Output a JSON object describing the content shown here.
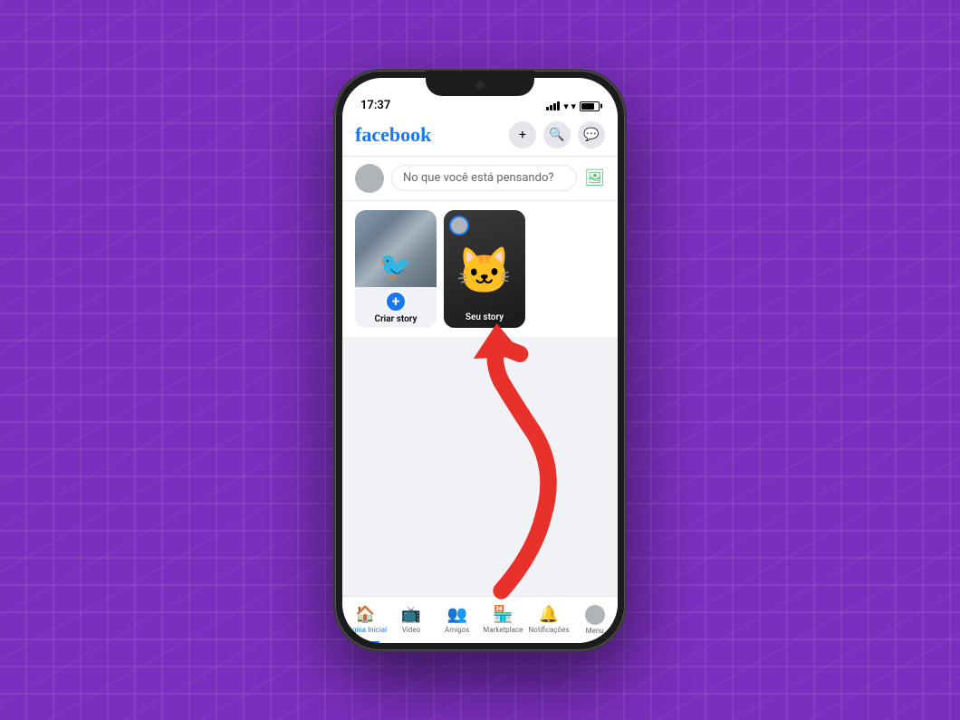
{
  "background": {
    "color": "#7b2fbe"
  },
  "status_bar": {
    "time": "17:37"
  },
  "header": {
    "logo": "facebook",
    "add_label": "+",
    "search_label": "🔍",
    "messenger_label": "💬"
  },
  "post_box": {
    "placeholder": "No que você está pensando?"
  },
  "stories": {
    "create_label": "Criar story",
    "my_story_label": "Seu story"
  },
  "bottom_nav": {
    "items": [
      {
        "label": "Página Inicial",
        "active": true
      },
      {
        "label": "Vídeo",
        "active": false
      },
      {
        "label": "Amigos",
        "active": false
      },
      {
        "label": "Marketplace",
        "active": false
      },
      {
        "label": "Notificações",
        "active": false
      },
      {
        "label": "Menu",
        "active": false
      }
    ]
  }
}
